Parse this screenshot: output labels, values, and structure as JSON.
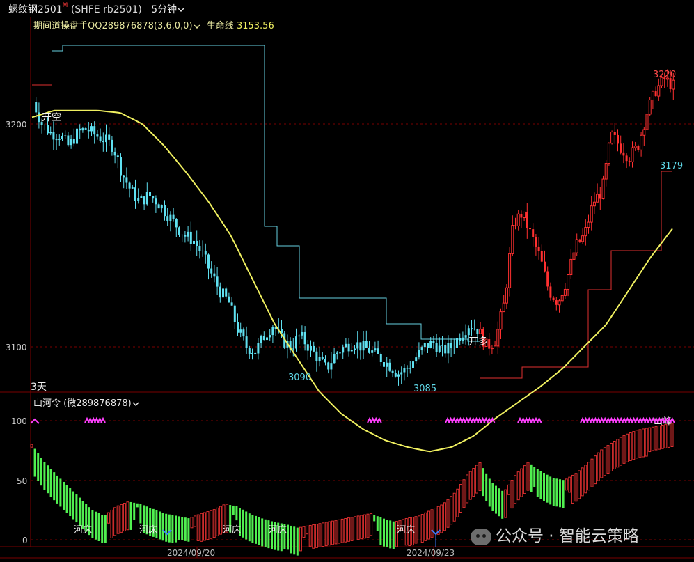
{
  "header": {
    "instrument": "螺纹钢2501",
    "marker": "M",
    "code": "(SHFE rb2501)",
    "period": "5分钟",
    "dropdown_icon": "chevron-down-icon"
  },
  "main_chart": {
    "indicator_name": "期间道操盘手QQ289876878(3,6,0,0)",
    "lifeline_label": "生命线",
    "lifeline_value": "3153.56",
    "y_labels": [
      "3200",
      "3100"
    ],
    "signal_short": "开空",
    "signal_long": "开多",
    "days_label": "3天",
    "lows": [
      "3090",
      "3085"
    ],
    "high": "3220",
    "stop_value": "3179"
  },
  "sub_chart": {
    "indicator_name": "山河令 (微289876878)",
    "y_labels": [
      "100",
      "50",
      "0"
    ],
    "bottom_label": "河床",
    "top_label": "山峰"
  },
  "x_axis": {
    "dates": [
      "2024/09/20",
      "2024/09/23"
    ]
  },
  "watermark": {
    "text": "公众号 · 智能云策略"
  },
  "chart_data": {
    "type": "candlestick",
    "series": [
      {
        "name": "K线",
        "approx_path": [
          3210,
          3200,
          3196,
          3195,
          3190,
          3196,
          3198,
          3195,
          3193,
          3190,
          3178,
          3170,
          3165,
          3168,
          3165,
          3160,
          3155,
          3150,
          3148,
          3142,
          3133,
          3125,
          3120,
          3108,
          3100,
          3098,
          3105,
          3110,
          3103,
          3100,
          3105,
          3100,
          3095,
          3090,
          3097,
          3100,
          3102,
          3100,
          3098,
          3095,
          3092,
          3088,
          3090,
          3095,
          3100,
          3102,
          3098,
          3100,
          3105,
          3110,
          3108,
          3100,
          3103,
          3120,
          3155,
          3160,
          3150,
          3140,
          3125,
          3120,
          3130,
          3145,
          3150,
          3165,
          3170,
          3195,
          3190,
          3185,
          3190,
          3205,
          3215,
          3220,
          3217
        ]
      },
      {
        "name": "生命线",
        "approx_path": [
          3203,
          3206,
          3206,
          3206,
          3205,
          3200,
          3190,
          3178,
          3165,
          3150,
          3130,
          3110,
          3095,
          3080,
          3070,
          3063,
          3058,
          3055,
          3053,
          3055,
          3060,
          3068,
          3075,
          3082,
          3090,
          3100,
          3110,
          3125,
          3140,
          3153
        ]
      }
    ],
    "sub_series": {
      "name": "山河令",
      "ylim": [
        0,
        100
      ],
      "approx_path": [
        80,
        66,
        55,
        45,
        35,
        25,
        20,
        28,
        32,
        30,
        26,
        22,
        20,
        18,
        22,
        25,
        30,
        28,
        22,
        18,
        15,
        13,
        10,
        12,
        14,
        16,
        18,
        20,
        22,
        18,
        15,
        18,
        20,
        25,
        30,
        40,
        55,
        65,
        48,
        40,
        55,
        65,
        58,
        52,
        50,
        56,
        65,
        75,
        82,
        88,
        92,
        94,
        96,
        98
      ]
    }
  }
}
